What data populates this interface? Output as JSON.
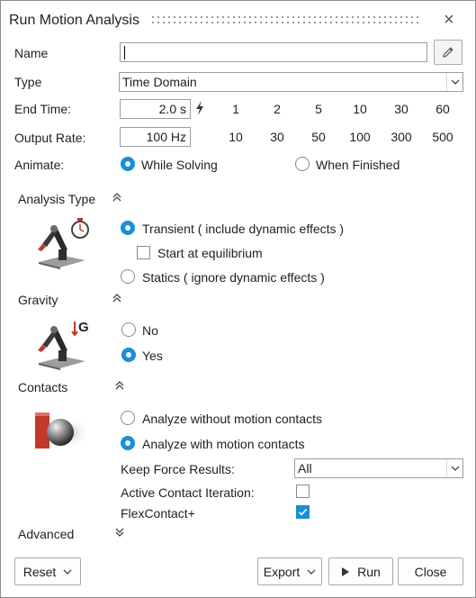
{
  "window": {
    "title": "Run Motion Analysis",
    "close_glyph": "×"
  },
  "name_row": {
    "label": "Name",
    "value": "",
    "edit_icon": "pencil-icon"
  },
  "type_row": {
    "label": "Type",
    "value": "Time Domain"
  },
  "end_time": {
    "label": "End Time:",
    "value": "2.0 s",
    "icon": "lightning-icon",
    "presets": [
      "1",
      "2",
      "5",
      "10",
      "30",
      "60"
    ]
  },
  "output_rate": {
    "label": "Output Rate:",
    "value": "100 Hz",
    "presets": [
      "10",
      "30",
      "50",
      "100",
      "300",
      "500"
    ]
  },
  "animate": {
    "label": "Animate:",
    "options": [
      "While Solving",
      "When Finished"
    ],
    "selected": "While Solving"
  },
  "analysis_type": {
    "title": "Analysis Type",
    "options": [
      "Transient ( include dynamic effects )",
      "Statics ( ignore dynamic effects )"
    ],
    "selected": "Transient ( include dynamic effects )",
    "start_at_equilibrium": {
      "label": "Start at equilibrium",
      "checked": false
    }
  },
  "gravity": {
    "title": "Gravity",
    "icon_letter": "G",
    "options": [
      "No",
      "Yes"
    ],
    "selected": "Yes"
  },
  "contacts": {
    "title": "Contacts",
    "options": [
      "Analyze without motion contacts",
      "Analyze with motion contacts"
    ],
    "selected": "Analyze with motion contacts",
    "keep_force_results": {
      "label": "Keep Force Results:",
      "value": "All"
    },
    "active_contact_iteration": {
      "label": "Active Contact Iteration:",
      "checked": false
    },
    "flexcontact": {
      "label": "FlexContact+",
      "checked": true
    }
  },
  "advanced": {
    "title": "Advanced"
  },
  "footer": {
    "reset": "Reset",
    "export": "Export",
    "run": "Run",
    "close": "Close"
  },
  "colors": {
    "accent": "#1a8fd6",
    "border": "#9c9c9c",
    "text": "#1f1f1f"
  }
}
